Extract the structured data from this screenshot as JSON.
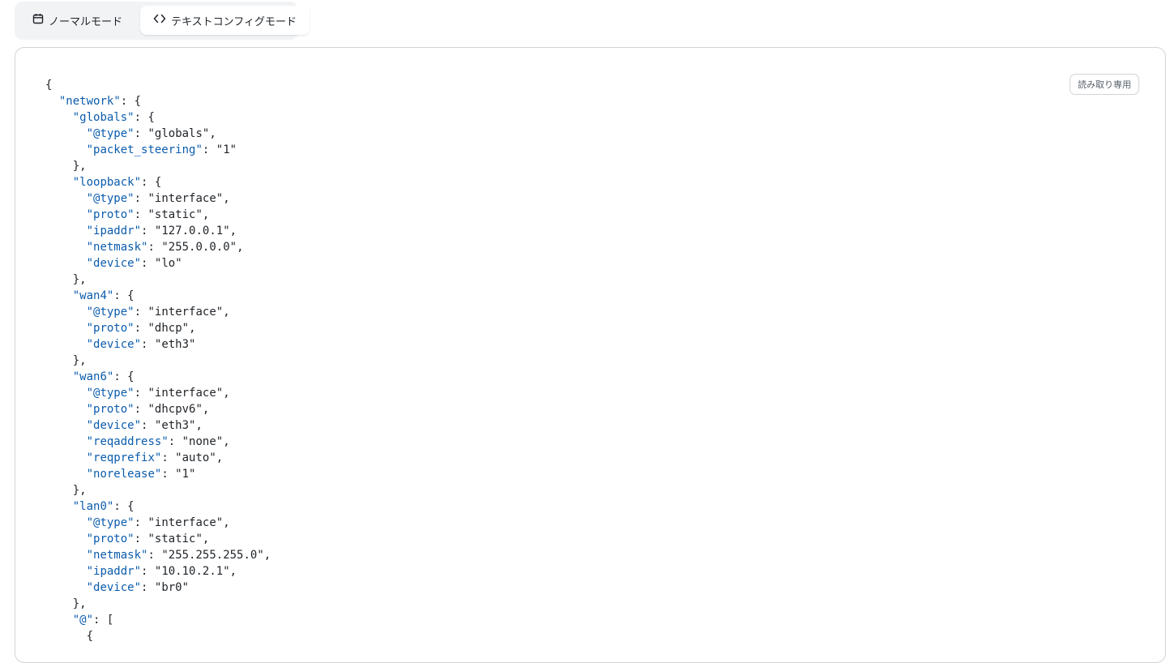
{
  "mode_tabs": [
    {
      "label": "ノーマルモード",
      "icon": "calendar-icon",
      "active": false
    },
    {
      "label": "テキストコンフィグモード",
      "icon": "code-icon",
      "active": true
    }
  ],
  "editor": {
    "readonly_label": "読み取り専用",
    "colors": {
      "key": "#0b5cad",
      "text": "#1f2328"
    },
    "lines": [
      {
        "indent": 0,
        "key": "",
        "value": "",
        "punc": "{"
      },
      {
        "indent": 1,
        "key": "network",
        "value": "",
        "punc": ": {"
      },
      {
        "indent": 2,
        "key": "globals",
        "value": "",
        "punc": ": {"
      },
      {
        "indent": 3,
        "key": "@type",
        "value": "globals",
        "punc": ","
      },
      {
        "indent": 3,
        "key": "packet_steering",
        "value": "1",
        "punc": ""
      },
      {
        "indent": 2,
        "key": "",
        "value": "",
        "punc": "},"
      },
      {
        "indent": 2,
        "key": "loopback",
        "value": "",
        "punc": ": {"
      },
      {
        "indent": 3,
        "key": "@type",
        "value": "interface",
        "punc": ","
      },
      {
        "indent": 3,
        "key": "proto",
        "value": "static",
        "punc": ","
      },
      {
        "indent": 3,
        "key": "ipaddr",
        "value": "127.0.0.1",
        "punc": ","
      },
      {
        "indent": 3,
        "key": "netmask",
        "value": "255.0.0.0",
        "punc": ","
      },
      {
        "indent": 3,
        "key": "device",
        "value": "lo",
        "punc": ""
      },
      {
        "indent": 2,
        "key": "",
        "value": "",
        "punc": "},"
      },
      {
        "indent": 2,
        "key": "wan4",
        "value": "",
        "punc": ": {"
      },
      {
        "indent": 3,
        "key": "@type",
        "value": "interface",
        "punc": ","
      },
      {
        "indent": 3,
        "key": "proto",
        "value": "dhcp",
        "punc": ","
      },
      {
        "indent": 3,
        "key": "device",
        "value": "eth3",
        "punc": ""
      },
      {
        "indent": 2,
        "key": "",
        "value": "",
        "punc": "},"
      },
      {
        "indent": 2,
        "key": "wan6",
        "value": "",
        "punc": ": {"
      },
      {
        "indent": 3,
        "key": "@type",
        "value": "interface",
        "punc": ","
      },
      {
        "indent": 3,
        "key": "proto",
        "value": "dhcpv6",
        "punc": ","
      },
      {
        "indent": 3,
        "key": "device",
        "value": "eth3",
        "punc": ","
      },
      {
        "indent": 3,
        "key": "reqaddress",
        "value": "none",
        "punc": ","
      },
      {
        "indent": 3,
        "key": "reqprefix",
        "value": "auto",
        "punc": ","
      },
      {
        "indent": 3,
        "key": "norelease",
        "value": "1",
        "punc": ""
      },
      {
        "indent": 2,
        "key": "",
        "value": "",
        "punc": "},"
      },
      {
        "indent": 2,
        "key": "lan0",
        "value": "",
        "punc": ": {"
      },
      {
        "indent": 3,
        "key": "@type",
        "value": "interface",
        "punc": ","
      },
      {
        "indent": 3,
        "key": "proto",
        "value": "static",
        "punc": ","
      },
      {
        "indent": 3,
        "key": "netmask",
        "value": "255.255.255.0",
        "punc": ","
      },
      {
        "indent": 3,
        "key": "ipaddr",
        "value": "10.10.2.1",
        "punc": ","
      },
      {
        "indent": 3,
        "key": "device",
        "value": "br0",
        "punc": ""
      },
      {
        "indent": 2,
        "key": "",
        "value": "",
        "punc": "},"
      },
      {
        "indent": 2,
        "key": "@",
        "value": "",
        "punc": ": ["
      },
      {
        "indent": 3,
        "key": "",
        "value": "",
        "punc": "{"
      }
    ]
  }
}
